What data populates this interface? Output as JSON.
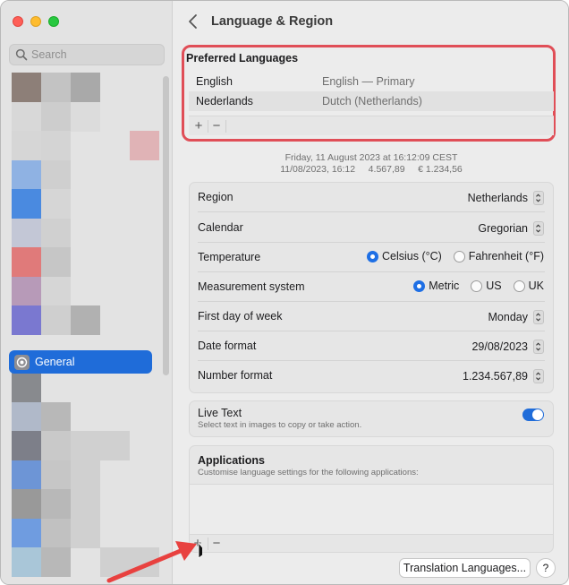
{
  "window": {
    "traffic_lights": [
      "close",
      "minimize",
      "zoom"
    ]
  },
  "sidebar": {
    "search_placeholder": "Search",
    "selected_item": {
      "label": "General",
      "icon": "gear-icon"
    },
    "pixel_colors": [
      "#8d7f78",
      "#c3c3c3",
      "#a9a9a9",
      "#d8d8d8",
      "#cdcdcd",
      "#dcdcdc",
      "#d6d6d6",
      "#d4d4d4",
      "#e0b3b6",
      "#8fb2e3",
      "#cfcfcf",
      "#4a8ae0",
      "#d6d6d6",
      "#c3c7d6",
      "#d0d0d0",
      "#e07a7a",
      "#c6c6c6",
      "#b79ab8",
      "#d6d6d6",
      "#7a78d0",
      "#cfcfcf",
      "#b1b1b1",
      "#888a8e",
      "#b0b9c9",
      "#b8b8b8",
      "#7d7f89",
      "#c9c9c9",
      "#6d95d6",
      "#c6c6c6",
      "#999999",
      "#b8b8b8",
      "#6f9ce0",
      "#c1c1c1",
      "#a9c6d8",
      "#b8b8b8"
    ]
  },
  "header": {
    "title": "Language & Region"
  },
  "preferred_languages": {
    "title": "Preferred Languages",
    "languages": [
      {
        "name": "English",
        "description": "English — Primary"
      },
      {
        "name": "Nederlands",
        "description": "Dutch (Netherlands)"
      }
    ],
    "add_label": "+",
    "remove_label": "−"
  },
  "preview": {
    "line1": "Friday, 11 August 2023 at 16:12:09 CEST",
    "line2": "11/08/2023, 16:12     4.567,89     € 1.234,56"
  },
  "settings": {
    "region": {
      "label": "Region",
      "value": "Netherlands"
    },
    "calendar": {
      "label": "Calendar",
      "value": "Gregorian"
    },
    "temperature": {
      "label": "Temperature",
      "options": [
        "Celsius (°C)",
        "Fahrenheit (°F)"
      ],
      "selected": "Celsius (°C)"
    },
    "measurement": {
      "label": "Measurement system",
      "options": [
        "Metric",
        "US",
        "UK"
      ],
      "selected": "Metric"
    },
    "first_day": {
      "label": "First day of week",
      "value": "Monday"
    },
    "date_format": {
      "label": "Date format",
      "value": "29/08/2023"
    },
    "number_format": {
      "label": "Number format",
      "value": "1.234.567,89"
    }
  },
  "live_text": {
    "label": "Live Text",
    "description": "Select text in images to copy or take action.",
    "enabled": true
  },
  "applications": {
    "title": "Applications",
    "description": "Customise language settings for the following applications:",
    "add_label": "+",
    "remove_label": "−"
  },
  "footer": {
    "translation_button": "Translation Languages...",
    "help_button": "?"
  },
  "colors": {
    "accent": "#1f6cd9",
    "highlight_border": "#e04e57",
    "annotation_arrow": "#e8413f"
  }
}
